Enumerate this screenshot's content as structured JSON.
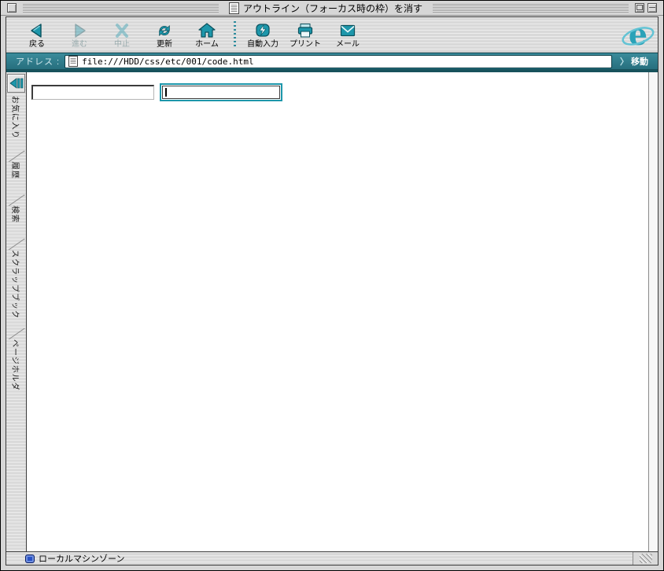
{
  "window": {
    "title": "アウトライン（フォーカス時の枠）を消す"
  },
  "toolbar": {
    "buttons": [
      {
        "id": "back",
        "label": "戻る",
        "disabled": false
      },
      {
        "id": "forward",
        "label": "進む",
        "disabled": true
      },
      {
        "id": "stop",
        "label": "中止",
        "disabled": true
      },
      {
        "id": "refresh",
        "label": "更新",
        "disabled": false
      },
      {
        "id": "home",
        "label": "ホーム",
        "disabled": false
      },
      {
        "id": "autofill",
        "label": "自動入力",
        "disabled": false
      },
      {
        "id": "print",
        "label": "プリント",
        "disabled": false
      },
      {
        "id": "mail",
        "label": "メール",
        "disabled": false
      }
    ]
  },
  "address": {
    "label": "アドレス :",
    "url": "file:///HDD/css/etc/001/code.html",
    "go_chevron": "〉",
    "go_label": "移動"
  },
  "sidebar": {
    "tabs": [
      {
        "label": "お気に入り"
      },
      {
        "label": "履歴"
      },
      {
        "label": "検索"
      },
      {
        "label": "スクラップブック"
      },
      {
        "label": "ページホルダ"
      }
    ]
  },
  "content": {
    "inputs": [
      {
        "value": "",
        "focused": false
      },
      {
        "value": "",
        "focused": true
      }
    ]
  },
  "statusbar": {
    "zone_text": "ローカルマシンゾーン"
  },
  "colors": {
    "accent_teal": "#1d97ab",
    "address_teal": "#2b7e8e",
    "divider_teal": "#17525c",
    "focus_ring": "#1d97ab",
    "zone_blue": "#2a52c4"
  }
}
